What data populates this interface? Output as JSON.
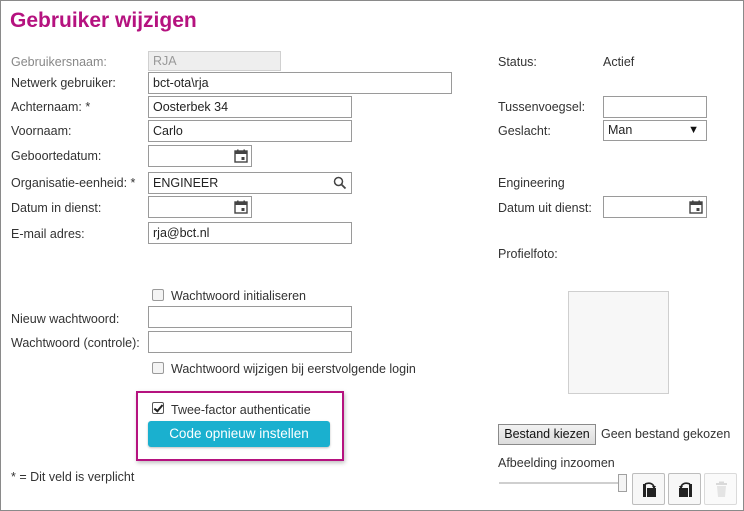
{
  "page": {
    "title": "Gebruiker wijzigen"
  },
  "left_form": {
    "gebruikersnaam": {
      "label": "Gebruikersnaam:",
      "value": "RJA"
    },
    "netwerk": {
      "label": "Netwerk gebruiker:",
      "value": "bct-ota\\rja"
    },
    "achternaam": {
      "label": "Achternaam: *",
      "value": "Oosterbek 34"
    },
    "voornaam": {
      "label": "Voornaam:",
      "value": "Carlo"
    },
    "geboortedatum": {
      "label": "Geboortedatum:",
      "value": ""
    },
    "organisatie": {
      "label": "Organisatie-eenheid: *",
      "value": "ENGINEER"
    },
    "in_dienst": {
      "label": "Datum in dienst:",
      "value": ""
    },
    "email": {
      "label": "E-mail adres:",
      "value": "rja@bct.nl"
    },
    "init_password": {
      "label": "Wachtwoord initialiseren",
      "checked": false
    },
    "new_password": {
      "label": "Nieuw wachtwoord:",
      "value": ""
    },
    "confirm_password": {
      "label": "Wachtwoord (controle):",
      "value": ""
    },
    "change_next_login": {
      "label": "Wachtwoord wijzigen bij eerstvolgende login",
      "checked": false
    },
    "two_factor": {
      "label": "Twee-factor authenticatie",
      "checked": true
    },
    "reset_code_button": "Code opnieuw instellen",
    "required_note": "* = Dit veld is verplicht"
  },
  "right_form": {
    "status": {
      "label": "Status:",
      "value": "Actief"
    },
    "tussenvoegsel": {
      "label": "Tussenvoegsel:",
      "value": ""
    },
    "geslacht": {
      "label": "Geslacht:",
      "value": "Man"
    },
    "org_name": "Engineering",
    "uit_dienst": {
      "label": "Datum uit dienst:",
      "value": ""
    },
    "profielfoto": {
      "label": "Profielfoto:"
    },
    "file_button": "Bestand kiezen",
    "file_status": "Geen bestand gekozen",
    "zoom_label": "Afbeelding inzoomen",
    "zoom_level": 0.96
  },
  "icons": {
    "calendar": "calendar-icon",
    "search": "search-icon",
    "rotate_left": "rotate-left-icon",
    "rotate_right": "rotate-right-icon",
    "delete": "trash-icon"
  },
  "colors": {
    "accent": "#b5127f",
    "primary_button": "#1ab0cf"
  }
}
